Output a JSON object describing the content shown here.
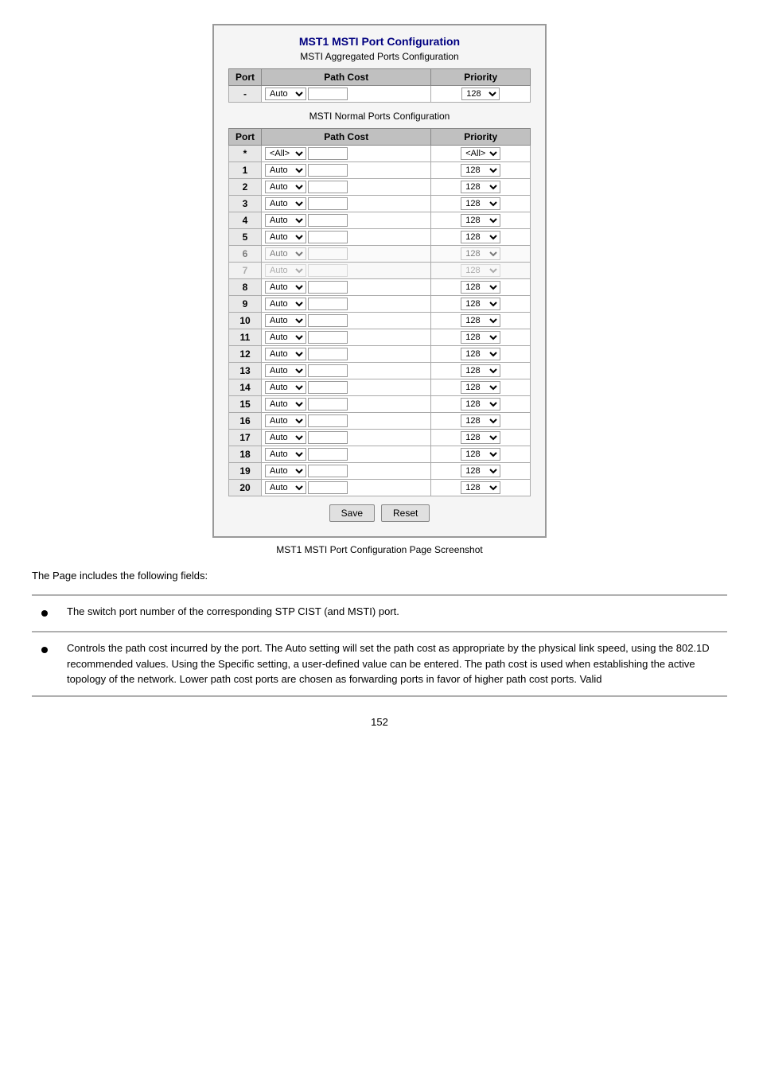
{
  "page": {
    "main_title": "MST1 MSTI Port Configuration",
    "aggregated_section_title": "MSTI Aggregated Ports Configuration",
    "normal_section_title": "MSTI Normal Ports Configuration",
    "caption": "MST1 MSTI Port Configuration Page Screenshot",
    "description_intro": "The Page includes the following fields:",
    "page_number": "152"
  },
  "table_headers": {
    "port": "Port",
    "path_cost": "Path Cost",
    "priority": "Priority"
  },
  "aggregated_row": {
    "port": "-",
    "path_cost_select": "Auto",
    "priority_select": "128"
  },
  "normal_rows": [
    {
      "port": "*",
      "path_cost": "<All>",
      "priority": "<All>"
    },
    {
      "port": "1",
      "path_cost": "Auto",
      "priority": "128"
    },
    {
      "port": "2",
      "path_cost": "Auto",
      "priority": "128"
    },
    {
      "port": "3",
      "path_cost": "Auto",
      "priority": "128"
    },
    {
      "port": "4",
      "path_cost": "Auto",
      "priority": "128"
    },
    {
      "port": "5",
      "path_cost": "Auto",
      "priority": "128"
    },
    {
      "port": "6",
      "path_cost": "Auto",
      "priority": "128"
    },
    {
      "port": "7",
      "path_cost": "Auto",
      "priority": "128"
    },
    {
      "port": "8",
      "path_cost": "Auto",
      "priority": "128"
    },
    {
      "port": "9",
      "path_cost": "Auto",
      "priority": "128"
    },
    {
      "port": "10",
      "path_cost": "Auto",
      "priority": "128"
    },
    {
      "port": "11",
      "path_cost": "Auto",
      "priority": "128"
    },
    {
      "port": "12",
      "path_cost": "Auto",
      "priority": "128"
    },
    {
      "port": "13",
      "path_cost": "Auto",
      "priority": "128"
    },
    {
      "port": "14",
      "path_cost": "Auto",
      "priority": "128"
    },
    {
      "port": "15",
      "path_cost": "Auto",
      "priority": "128"
    },
    {
      "port": "16",
      "path_cost": "Auto",
      "priority": "128"
    },
    {
      "port": "17",
      "path_cost": "Auto",
      "priority": "128"
    },
    {
      "port": "18",
      "path_cost": "Auto",
      "priority": "128"
    },
    {
      "port": "19",
      "path_cost": "Auto",
      "priority": "128"
    },
    {
      "port": "20",
      "path_cost": "Auto",
      "priority": "128"
    }
  ],
  "buttons": {
    "save": "Save",
    "reset": "Reset"
  },
  "info_rows": [
    {
      "text": "The switch port number of the corresponding STP CIST (and MSTI) port."
    },
    {
      "text": "Controls the path cost incurred by the port. The Auto setting will set the path cost as appropriate by the physical link speed, using the 802.1D recommended values. Using the Specific setting, a user-defined value can be entered. The path cost is used when establishing the active topology of the network. Lower path cost ports are chosen as forwarding ports in favor of higher path cost ports. Valid"
    }
  ]
}
